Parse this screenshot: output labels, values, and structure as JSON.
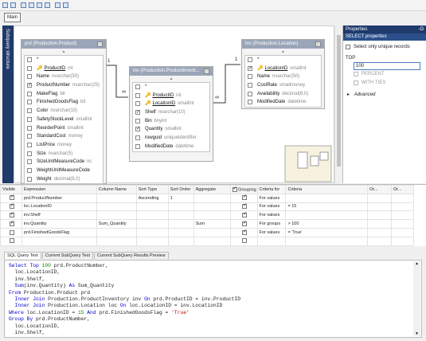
{
  "toolbar": {
    "icons": [
      "layout-icon",
      "open-icon",
      "add-table-icon",
      "add-derived-icon",
      "copy-icon",
      "properties-icon",
      "grid-icon",
      "sql-icon"
    ]
  },
  "main_tab": "Main",
  "vertical_tab": "Subquery structure",
  "tables": [
    {
      "title": "prd (Production.Product)",
      "color": "#9aa6b8",
      "rows": [
        {
          "name": "*",
          "type": "",
          "checked": false,
          "key": false,
          "underline": false
        },
        {
          "name": "ProductID",
          "type": "int",
          "checked": false,
          "key": true,
          "underline": true
        },
        {
          "name": "Name",
          "type": "nvarchar(50)",
          "checked": false,
          "key": false,
          "underline": false
        },
        {
          "name": "ProductNumber",
          "type": "nvarchar(25)",
          "checked": true,
          "key": false,
          "underline": false
        },
        {
          "name": "MakeFlag",
          "type": "bit",
          "checked": false,
          "key": false,
          "underline": false
        },
        {
          "name": "FinishedGoodsFlag",
          "type": "bit",
          "checked": false,
          "key": false,
          "underline": false
        },
        {
          "name": "Color",
          "type": "nvarchar(15)",
          "checked": false,
          "key": false,
          "underline": false
        },
        {
          "name": "SafetyStockLevel",
          "type": "smallint",
          "checked": false,
          "key": false,
          "underline": false
        },
        {
          "name": "ReorderPoint",
          "type": "smallint",
          "checked": false,
          "key": false,
          "underline": false
        },
        {
          "name": "StandardCost",
          "type": "money",
          "checked": false,
          "key": false,
          "underline": false
        },
        {
          "name": "ListPrice",
          "type": "money",
          "checked": false,
          "key": false,
          "underline": false
        },
        {
          "name": "Size",
          "type": "nvarchar(5)",
          "checked": false,
          "key": false,
          "underline": false
        },
        {
          "name": "SizeUnitMeasureCode",
          "type": "nc",
          "checked": false,
          "key": false,
          "underline": false
        },
        {
          "name": "WeightUnitMeasureCode",
          "type": "",
          "checked": false,
          "key": false,
          "underline": false
        },
        {
          "name": "Weight",
          "type": "decimal(8,0)",
          "checked": false,
          "key": false,
          "underline": false
        }
      ]
    },
    {
      "title": "inv (Production.ProductInvent...",
      "color": "#9aa6b8",
      "rows": [
        {
          "name": "*",
          "type": "",
          "checked": false,
          "key": false,
          "underline": false
        },
        {
          "name": "ProductID",
          "type": "int",
          "checked": false,
          "key": true,
          "underline": true
        },
        {
          "name": "LocationID",
          "type": "smallint",
          "checked": false,
          "key": true,
          "underline": true
        },
        {
          "name": "Shelf",
          "type": "nvarchar(10)",
          "checked": true,
          "key": false,
          "underline": false
        },
        {
          "name": "Bin",
          "type": "tinyint",
          "checked": false,
          "key": false,
          "underline": false
        },
        {
          "name": "Quantity",
          "type": "smallint",
          "checked": true,
          "key": false,
          "underline": false
        },
        {
          "name": "rowguid",
          "type": "uniqueidentifier",
          "checked": false,
          "key": false,
          "underline": false
        },
        {
          "name": "ModifiedDate",
          "type": "datetime",
          "checked": false,
          "key": false,
          "underline": false
        }
      ]
    },
    {
      "title": "loc (Production.Location)",
      "color": "#9aa6b8",
      "rows": [
        {
          "name": "*",
          "type": "",
          "checked": false,
          "key": false,
          "underline": false
        },
        {
          "name": "LocationID",
          "type": "smallint",
          "checked": true,
          "key": true,
          "underline": true
        },
        {
          "name": "Name",
          "type": "nvarchar(50)",
          "checked": false,
          "key": false,
          "underline": false
        },
        {
          "name": "CostRate",
          "type": "smallmoney",
          "checked": false,
          "key": false,
          "underline": false
        },
        {
          "name": "Availability",
          "type": "decimal(8,0)",
          "checked": false,
          "key": false,
          "underline": false
        },
        {
          "name": "ModifiedDate",
          "type": "datetime",
          "checked": false,
          "key": false,
          "underline": false
        }
      ]
    }
  ],
  "links": {
    "one_a": "1",
    "many_a": "∞",
    "one_b": "1",
    "many_b": "∞"
  },
  "properties": {
    "header": "Properties",
    "pin": "-Ω",
    "section": "SELECT properties",
    "select_only_unique": "Select only unique records",
    "top_label": "TOP",
    "top_value": "100",
    "percent": "PERCENT",
    "with_ties": "WITH TIES",
    "advanced": "Advanced"
  },
  "grid": {
    "headers": [
      "Visible",
      "Expression",
      "Column Name",
      "Sort Type",
      "Sort Order",
      "Aggregate",
      "Grouping",
      "Criteria for",
      "Criteria",
      "Or...",
      "Or..."
    ],
    "rows": [
      {
        "visible": true,
        "expr": "prd.ProductNumber",
        "col": "",
        "sort_type": "Ascending",
        "sort_order": "1",
        "agg": "",
        "grouping": true,
        "crit_for": "For values",
        "crit": ""
      },
      {
        "visible": true,
        "expr": "loc.LocationID",
        "col": "",
        "sort_type": "",
        "sort_order": "",
        "agg": "",
        "grouping": true,
        "crit_for": "For values",
        "crit": "= 15"
      },
      {
        "visible": true,
        "expr": "inv.Shelf",
        "col": "",
        "sort_type": "",
        "sort_order": "",
        "agg": "",
        "grouping": true,
        "crit_for": "For values",
        "crit": ""
      },
      {
        "visible": true,
        "expr": "inv.Quantity",
        "col": "Sum_Quantity",
        "sort_type": "",
        "sort_order": "",
        "agg": "Sum",
        "grouping": true,
        "crit_for": "For groups",
        "crit": "> 100"
      },
      {
        "visible": false,
        "expr": "prd.FinishedGoodsFlag",
        "col": "",
        "sort_type": "",
        "sort_order": "",
        "agg": "",
        "grouping": true,
        "crit_for": "For values",
        "crit": "= 'True'"
      },
      {
        "visible": false,
        "expr": "",
        "col": "",
        "sort_type": "",
        "sort_order": "",
        "agg": "",
        "grouping": false,
        "crit_for": "",
        "crit": ""
      }
    ]
  },
  "sql_tabs": [
    "SQL Query Text",
    "Current SubQuery Text",
    "Current SubQuery Results Preview"
  ],
  "sql_lines": [
    [
      {
        "t": "Select Top ",
        "k": "kw"
      },
      {
        "t": "100",
        "k": "num"
      },
      {
        "t": " prd.ProductNumber,",
        "k": ""
      }
    ],
    [
      {
        "t": "  loc.LocationID,",
        "k": ""
      }
    ],
    [
      {
        "t": "  inv.Shelf,",
        "k": ""
      }
    ],
    [
      {
        "t": "  Sum",
        "k": "kw"
      },
      {
        "t": "(inv.Quantity) ",
        "k": ""
      },
      {
        "t": "As",
        "k": "kw"
      },
      {
        "t": " Sum_Quantity",
        "k": ""
      }
    ],
    [
      {
        "t": "From",
        "k": "kw"
      },
      {
        "t": " Production.Product prd",
        "k": ""
      }
    ],
    [
      {
        "t": "  Inner Join",
        "k": "kw"
      },
      {
        "t": " Production.ProductInventory inv ",
        "k": ""
      },
      {
        "t": "On",
        "k": "kw"
      },
      {
        "t": " prd.ProductID = inv.ProductID",
        "k": ""
      }
    ],
    [
      {
        "t": "  Inner Join",
        "k": "kw"
      },
      {
        "t": " Production.Location loc ",
        "k": ""
      },
      {
        "t": "On",
        "k": "kw"
      },
      {
        "t": " loc.LocationID = inv.LocationID",
        "k": ""
      }
    ],
    [
      {
        "t": "Where",
        "k": "kw"
      },
      {
        "t": " loc.LocationID = ",
        "k": ""
      },
      {
        "t": "15",
        "k": "num"
      },
      {
        "t": " And",
        "k": "kw"
      },
      {
        "t": " prd.FinishedGoodsFlag = ",
        "k": ""
      },
      {
        "t": "'True'",
        "k": "str"
      }
    ],
    [
      {
        "t": "Group By",
        "k": "kw"
      },
      {
        "t": " prd.ProductNumber,",
        "k": ""
      }
    ],
    [
      {
        "t": "  loc.LocationID,",
        "k": ""
      }
    ],
    [
      {
        "t": "  inv.Shelf,",
        "k": ""
      }
    ]
  ]
}
